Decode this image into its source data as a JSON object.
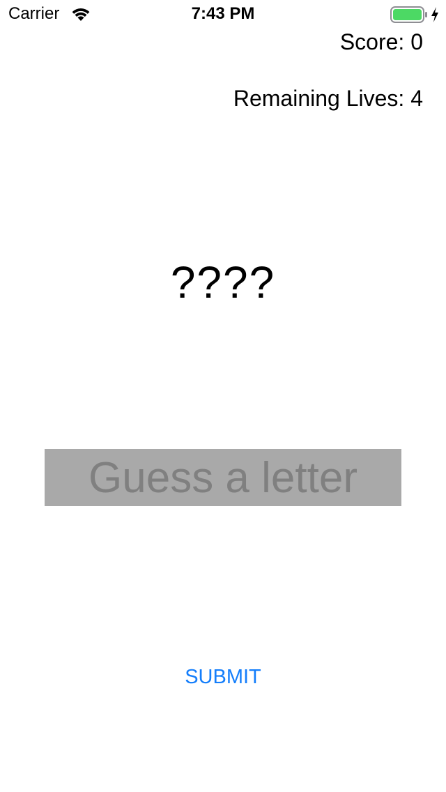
{
  "status_bar": {
    "carrier": "Carrier",
    "time": "7:43 PM",
    "wifi_icon": "wifi-icon",
    "battery_icon": "battery-full-icon",
    "charging_icon": "charging-bolt-icon",
    "battery_level": 1.0,
    "battery_color": "#4cd964"
  },
  "game": {
    "score_text": "Score: 0",
    "lives_text": "Remaining Lives: 4",
    "masked_word": "????"
  },
  "guess_input": {
    "value": "",
    "placeholder": "Guess a letter",
    "background": "#a9a9a9"
  },
  "submit": {
    "label": "SUBMIT",
    "color": "#147efb"
  }
}
